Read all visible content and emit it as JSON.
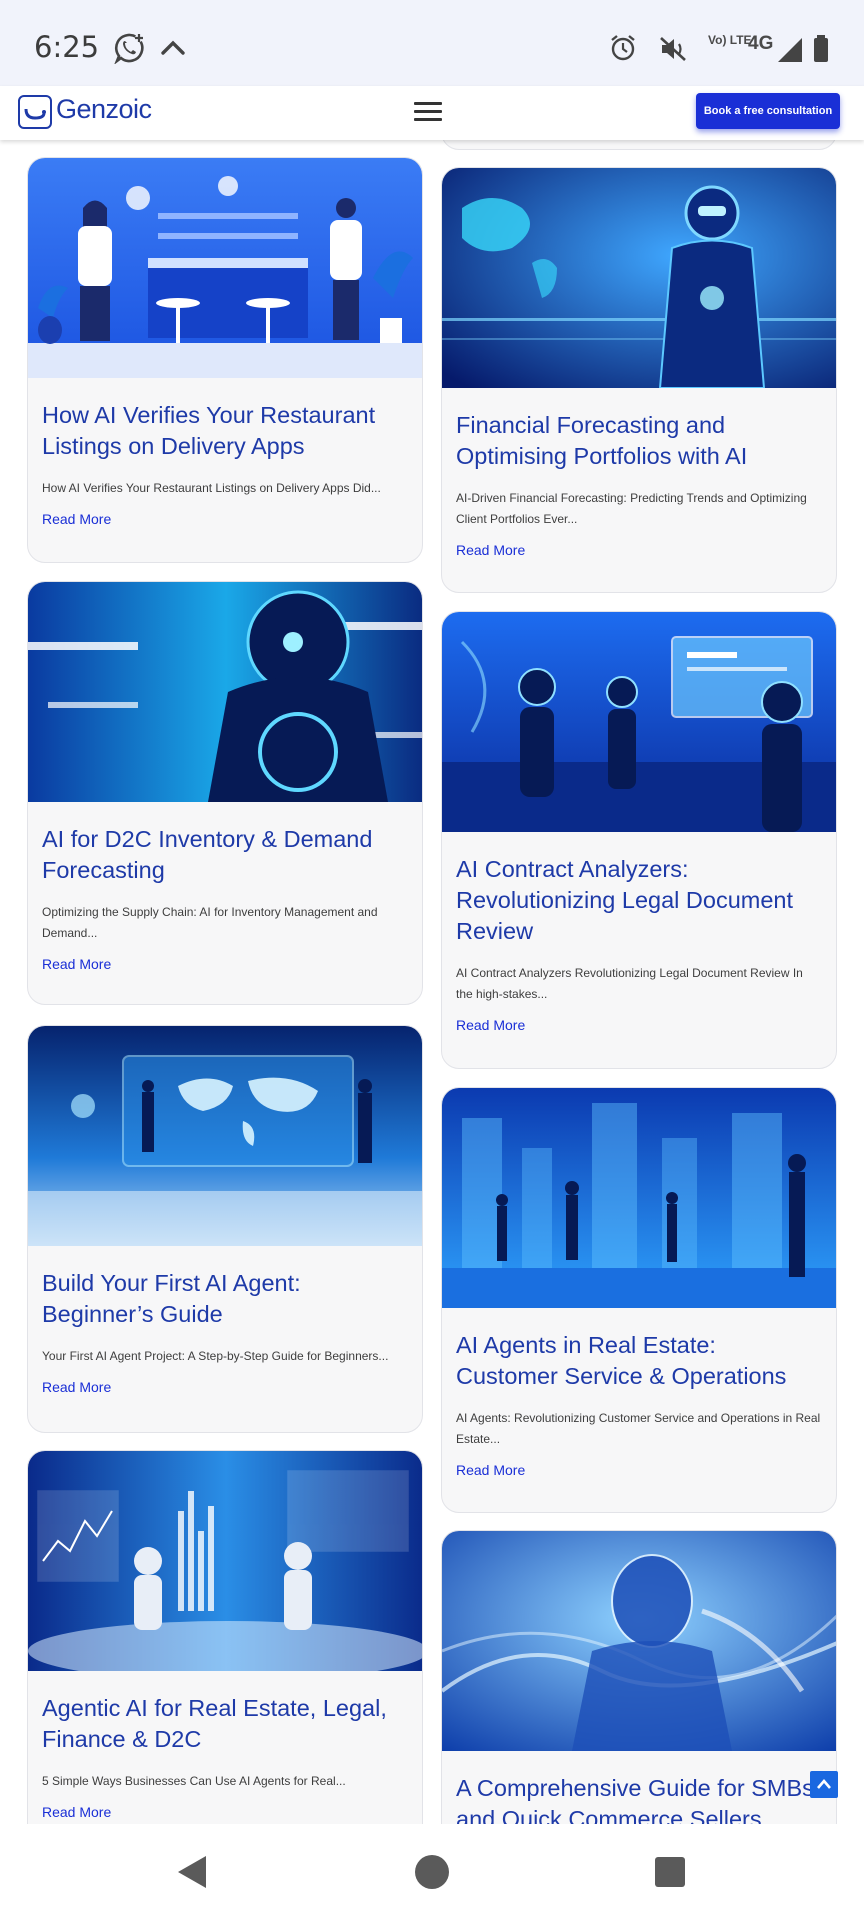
{
  "status_bar": {
    "time": "6:25",
    "network_lte": "Vo) LTE",
    "network_4g": "4G",
    "icons": [
      "whatsapp-icon",
      "chevron-up-icon",
      "alarm-icon",
      "mute-icon",
      "signal-icon",
      "battery-icon"
    ]
  },
  "nav": {
    "logo_text": "Genzoic",
    "cta_label": "Book a free consultation",
    "accent": "#1a2fd6",
    "brand_color": "#1e3aa8"
  },
  "cards": [
    {
      "title": "How AI Verifies Your Restaurant Listings on Delivery Apps",
      "excerpt": "How AI Verifies Your Restaurant Listings on Delivery Apps Did...",
      "read_more": "Read More"
    },
    {
      "title": "Financial Forecasting and Optimising Portfolios with AI",
      "excerpt": "AI-Driven Financial Forecasting: Predicting Trends and Optimizing Client Portfolios Ever...",
      "read_more": "Read More"
    },
    {
      "title": "AI for D2C Inventory & Demand Forecasting",
      "excerpt": "Optimizing the Supply Chain: AI for Inventory Management and Demand...",
      "read_more": "Read More"
    },
    {
      "title": "AI Contract Analyzers: Revolutionizing Legal Document Review",
      "excerpt": "AI Contract Analyzers Revolutionizing Legal Document Review In the high-stakes...",
      "read_more": "Read More"
    },
    {
      "title": "Build Your First AI Agent: Beginner’s Guide",
      "excerpt": "Your First AI Agent Project: A Step-by-Step Guide for Beginners...",
      "read_more": "Read More"
    },
    {
      "title": "AI Agents in Real Estate: Customer Service & Operations",
      "excerpt": "AI Agents: Revolutionizing Customer Service and Operations in Real Estate...",
      "read_more": "Read More"
    },
    {
      "title": "Agentic AI for Real Estate, Legal, Finance & D2C",
      "excerpt": "5 Simple Ways Businesses Can Use AI Agents for Real...",
      "read_more": "Read More"
    },
    {
      "title": "A Comprehensive Guide for SMBs and Quick Commerce Sellers",
      "excerpt": "",
      "read_more": ""
    }
  ]
}
